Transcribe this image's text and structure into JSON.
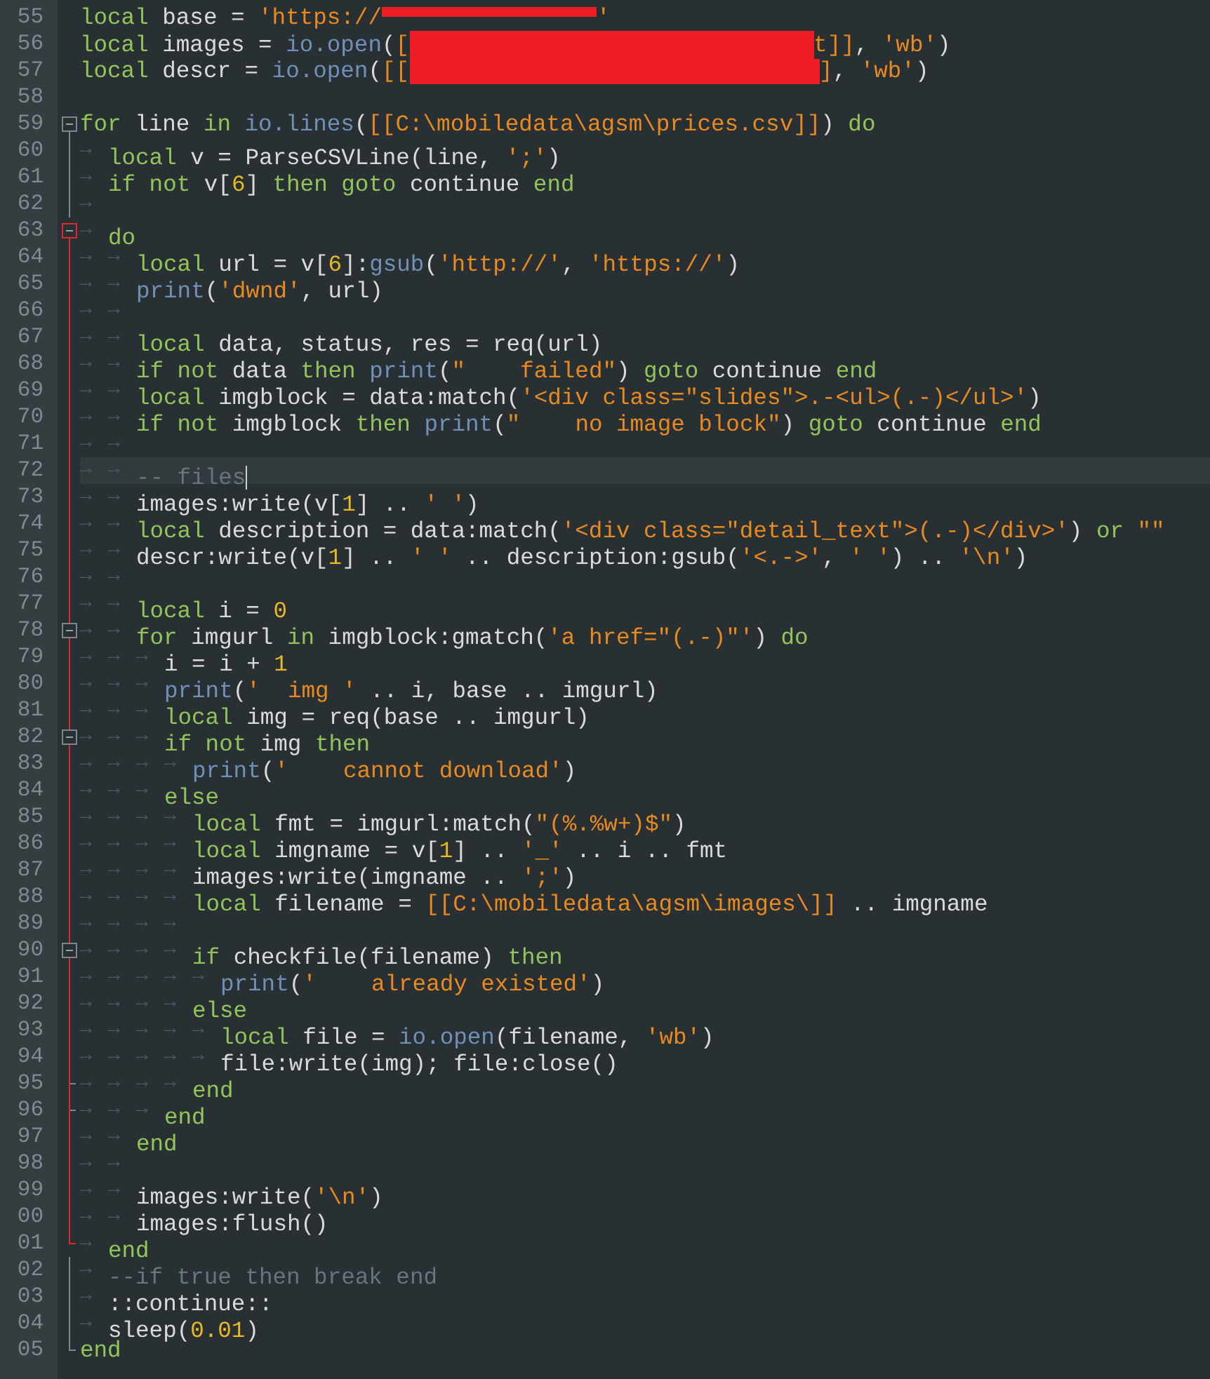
{
  "editor": {
    "lines": [
      {
        "number": "55",
        "current": false,
        "tokens": [
          {
            "kind": "keyword",
            "text": "local"
          },
          {
            "kind": "plain",
            "text": " base = "
          },
          {
            "kind": "string",
            "text": "'https://"
          },
          {
            "kind": "redacted"
          },
          {
            "kind": "string",
            "text": "'"
          }
        ]
      },
      {
        "number": "56",
        "current": false,
        "tokens": [
          {
            "kind": "keyword",
            "text": "local"
          },
          {
            "kind": "plain",
            "text": " images = "
          },
          {
            "kind": "function",
            "text": "io.open"
          },
          {
            "kind": "plain",
            "text": "("
          },
          {
            "kind": "string",
            "text": "["
          },
          {
            "kind": "redacted"
          },
          {
            "kind": "string",
            "text": "t]]"
          },
          {
            "kind": "plain",
            "text": ", "
          },
          {
            "kind": "string",
            "text": "'wb'"
          },
          {
            "kind": "plain",
            "text": ")"
          }
        ]
      },
      {
        "number": "57",
        "current": false,
        "tokens": [
          {
            "kind": "keyword",
            "text": "local"
          },
          {
            "kind": "plain",
            "text": " descr = "
          },
          {
            "kind": "function",
            "text": "io.open"
          },
          {
            "kind": "plain",
            "text": "("
          },
          {
            "kind": "string",
            "text": "[["
          },
          {
            "kind": "redacted"
          },
          {
            "kind": "string",
            "text": "]"
          },
          {
            "kind": "plain",
            "text": ", "
          },
          {
            "kind": "string",
            "text": "'wb'"
          },
          {
            "kind": "plain",
            "text": ")"
          }
        ]
      },
      {
        "number": "58",
        "current": false
      },
      {
        "number": "59",
        "current": false,
        "fold": {
          "kind": "open",
          "active": false
        },
        "tokens": [
          {
            "kind": "keyword",
            "text": "for"
          },
          {
            "kind": "plain",
            "text": " line "
          },
          {
            "kind": "keyword",
            "text": "in "
          },
          {
            "kind": "function",
            "text": "io.lines"
          },
          {
            "kind": "plain",
            "text": "("
          },
          {
            "kind": "string",
            "text": "[[C:\\mobiledata\\agsm\\prices.csv]]"
          },
          {
            "kind": "plain",
            "text": ") "
          },
          {
            "kind": "keyword",
            "text": "do"
          }
        ]
      },
      {
        "number": "60",
        "current": false,
        "fold": {
          "kind": "line",
          "active": false
        },
        "tokens": [
          {
            "kind": "tab",
            "text": "→"
          },
          {
            "kind": "keyword",
            "text": "local"
          },
          {
            "kind": "plain",
            "text": " v = ParseCSVLine(line, "
          },
          {
            "kind": "string",
            "text": "';'"
          },
          {
            "kind": "plain",
            "text": ")"
          }
        ]
      },
      {
        "number": "61",
        "current": false,
        "fold": {
          "kind": "line",
          "active": false
        },
        "tokens": [
          {
            "kind": "tab",
            "text": "→"
          },
          {
            "kind": "keyword",
            "text": "if not"
          },
          {
            "kind": "plain",
            "text": " v["
          },
          {
            "kind": "number",
            "text": "6"
          },
          {
            "kind": "plain",
            "text": "] "
          },
          {
            "kind": "keyword",
            "text": "then goto"
          },
          {
            "kind": "plain",
            "text": " continue "
          },
          {
            "kind": "keyword",
            "text": "end"
          }
        ]
      },
      {
        "number": "62",
        "current": false,
        "fold": {
          "kind": "line",
          "active": false
        },
        "tokens": [
          {
            "kind": "tab",
            "text": "→"
          }
        ]
      },
      {
        "number": "63",
        "current": false,
        "fold": {
          "kind": "open",
          "active": true
        },
        "tokens": [
          {
            "kind": "tab",
            "text": "→"
          },
          {
            "kind": "keyword",
            "text": "do"
          }
        ]
      },
      {
        "number": "64",
        "current": false,
        "fold": {
          "kind": "line",
          "active": true
        },
        "tokens": [
          {
            "kind": "tab",
            "text": "→"
          },
          {
            "kind": "tab",
            "text": "→"
          },
          {
            "kind": "keyword",
            "text": "local"
          },
          {
            "kind": "plain",
            "text": " url = v["
          },
          {
            "kind": "number",
            "text": "6"
          },
          {
            "kind": "plain",
            "text": "]:"
          },
          {
            "kind": "function",
            "text": "gsub"
          },
          {
            "kind": "plain",
            "text": "("
          },
          {
            "kind": "string",
            "text": "'http://'"
          },
          {
            "kind": "plain",
            "text": ", "
          },
          {
            "kind": "string",
            "text": "'https://'"
          },
          {
            "kind": "plain",
            "text": ")"
          }
        ]
      },
      {
        "number": "65",
        "current": false,
        "fold": {
          "kind": "line",
          "active": true
        },
        "tokens": [
          {
            "kind": "tab",
            "text": "→"
          },
          {
            "kind": "tab",
            "text": "→"
          },
          {
            "kind": "function",
            "text": "print"
          },
          {
            "kind": "plain",
            "text": "("
          },
          {
            "kind": "string",
            "text": "'dwnd'"
          },
          {
            "kind": "plain",
            "text": ", url)"
          }
        ]
      },
      {
        "number": "66",
        "current": false,
        "fold": {
          "kind": "line",
          "active": true
        },
        "tokens": [
          {
            "kind": "tab",
            "text": "→"
          },
          {
            "kind": "tab",
            "text": "→"
          }
        ]
      },
      {
        "number": "67",
        "current": false,
        "fold": {
          "kind": "line",
          "active": true
        },
        "tokens": [
          {
            "kind": "tab",
            "text": "→"
          },
          {
            "kind": "tab",
            "text": "→"
          },
          {
            "kind": "keyword",
            "text": "local"
          },
          {
            "kind": "plain",
            "text": " data, status, res = req(url)"
          }
        ]
      },
      {
        "number": "68",
        "current": false,
        "fold": {
          "kind": "line",
          "active": true
        },
        "tokens": [
          {
            "kind": "tab",
            "text": "→"
          },
          {
            "kind": "tab",
            "text": "→"
          },
          {
            "kind": "keyword",
            "text": "if not"
          },
          {
            "kind": "plain",
            "text": " data "
          },
          {
            "kind": "keyword",
            "text": "then "
          },
          {
            "kind": "function",
            "text": "print"
          },
          {
            "kind": "plain",
            "text": "("
          },
          {
            "kind": "string",
            "text": "\"    failed\""
          },
          {
            "kind": "plain",
            "text": ") "
          },
          {
            "kind": "keyword",
            "text": "goto"
          },
          {
            "kind": "plain",
            "text": " continue "
          },
          {
            "kind": "keyword",
            "text": "end"
          }
        ]
      },
      {
        "number": "69",
        "current": false,
        "fold": {
          "kind": "line",
          "active": true
        },
        "tokens": [
          {
            "kind": "tab",
            "text": "→"
          },
          {
            "kind": "tab",
            "text": "→"
          },
          {
            "kind": "keyword",
            "text": "local"
          },
          {
            "kind": "plain",
            "text": " imgblock = data:match("
          },
          {
            "kind": "string",
            "text": "'<div class=\"slides\">.-<ul>(.-)</ul>'"
          },
          {
            "kind": "plain",
            "text": ")"
          }
        ]
      },
      {
        "number": "70",
        "current": false,
        "fold": {
          "kind": "line",
          "active": true
        },
        "tokens": [
          {
            "kind": "tab",
            "text": "→"
          },
          {
            "kind": "tab",
            "text": "→"
          },
          {
            "kind": "keyword",
            "text": "if not"
          },
          {
            "kind": "plain",
            "text": " imgblock "
          },
          {
            "kind": "keyword",
            "text": "then "
          },
          {
            "kind": "function",
            "text": "print"
          },
          {
            "kind": "plain",
            "text": "("
          },
          {
            "kind": "string",
            "text": "\"    no image block\""
          },
          {
            "kind": "plain",
            "text": ") "
          },
          {
            "kind": "keyword",
            "text": "goto"
          },
          {
            "kind": "plain",
            "text": " continue "
          },
          {
            "kind": "keyword",
            "text": "end"
          }
        ]
      },
      {
        "number": "71",
        "current": false,
        "fold": {
          "kind": "line",
          "active": true
        },
        "tokens": [
          {
            "kind": "tab",
            "text": "→"
          },
          {
            "kind": "tab",
            "text": "→"
          }
        ]
      },
      {
        "number": "72",
        "current": true,
        "fold": {
          "kind": "line",
          "active": true
        },
        "tokens": [
          {
            "kind": "tab",
            "text": "→"
          },
          {
            "kind": "tab",
            "text": "→"
          },
          {
            "kind": "comment",
            "text": "-- files"
          }
        ]
      },
      {
        "number": "73",
        "current": false,
        "fold": {
          "kind": "line",
          "active": true
        },
        "tokens": [
          {
            "kind": "tab",
            "text": "→"
          },
          {
            "kind": "tab",
            "text": "→"
          },
          {
            "kind": "plain",
            "text": "images:write(v["
          },
          {
            "kind": "number",
            "text": "1"
          },
          {
            "kind": "plain",
            "text": "] .. "
          },
          {
            "kind": "string",
            "text": "' '"
          },
          {
            "kind": "plain",
            "text": ")"
          }
        ]
      },
      {
        "number": "74",
        "current": false,
        "fold": {
          "kind": "line",
          "active": true
        },
        "tokens": [
          {
            "kind": "tab",
            "text": "→"
          },
          {
            "kind": "tab",
            "text": "→"
          },
          {
            "kind": "keyword",
            "text": "local"
          },
          {
            "kind": "plain",
            "text": " description = data:match("
          },
          {
            "kind": "string",
            "text": "'<div class=\"detail_text\">(.-)</div>'"
          },
          {
            "kind": "plain",
            "text": ") "
          },
          {
            "kind": "keyword",
            "text": "or "
          },
          {
            "kind": "string",
            "text": "\"\""
          }
        ]
      },
      {
        "number": "75",
        "current": false,
        "fold": {
          "kind": "line",
          "active": true
        },
        "tokens": [
          {
            "kind": "tab",
            "text": "→"
          },
          {
            "kind": "tab",
            "text": "→"
          },
          {
            "kind": "plain",
            "text": "descr:write(v["
          },
          {
            "kind": "number",
            "text": "1"
          },
          {
            "kind": "plain",
            "text": "] .. "
          },
          {
            "kind": "string",
            "text": "' '"
          },
          {
            "kind": "plain",
            "text": " .. description:gsub("
          },
          {
            "kind": "string",
            "text": "'<.->'"
          },
          {
            "kind": "plain",
            "text": ", "
          },
          {
            "kind": "string",
            "text": "' '"
          },
          {
            "kind": "plain",
            "text": ") .. "
          },
          {
            "kind": "string",
            "text": "'\\n'"
          },
          {
            "kind": "plain",
            "text": ")"
          }
        ]
      },
      {
        "number": "76",
        "current": false,
        "fold": {
          "kind": "line",
          "active": true
        },
        "tokens": [
          {
            "kind": "tab",
            "text": "→"
          },
          {
            "kind": "tab",
            "text": "→"
          }
        ]
      },
      {
        "number": "77",
        "current": false,
        "fold": {
          "kind": "line",
          "active": true
        },
        "tokens": [
          {
            "kind": "tab",
            "text": "→"
          },
          {
            "kind": "tab",
            "text": "→"
          },
          {
            "kind": "keyword",
            "text": "local"
          },
          {
            "kind": "plain",
            "text": " i = "
          },
          {
            "kind": "number",
            "text": "0"
          }
        ]
      },
      {
        "number": "78",
        "current": false,
        "fold": {
          "kind": "nested",
          "active": true
        },
        "tokens": [
          {
            "kind": "tab",
            "text": "→"
          },
          {
            "kind": "tab",
            "text": "→"
          },
          {
            "kind": "keyword",
            "text": "for"
          },
          {
            "kind": "plain",
            "text": " imgurl "
          },
          {
            "kind": "keyword",
            "text": "in"
          },
          {
            "kind": "plain",
            "text": " imgblock:gmatch("
          },
          {
            "kind": "string",
            "text": "'a href=\"(.-)\"'"
          },
          {
            "kind": "plain",
            "text": ") "
          },
          {
            "kind": "keyword",
            "text": "do"
          }
        ]
      },
      {
        "number": "79",
        "current": false,
        "fold": {
          "kind": "line",
          "active": true
        },
        "tokens": [
          {
            "kind": "tab",
            "text": "→"
          },
          {
            "kind": "tab",
            "text": "→"
          },
          {
            "kind": "tab",
            "text": "→"
          },
          {
            "kind": "plain",
            "text": "i = i + "
          },
          {
            "kind": "number",
            "text": "1"
          }
        ]
      },
      {
        "number": "80",
        "current": false,
        "fold": {
          "kind": "line",
          "active": true
        },
        "tokens": [
          {
            "kind": "tab",
            "text": "→"
          },
          {
            "kind": "tab",
            "text": "→"
          },
          {
            "kind": "tab",
            "text": "→"
          },
          {
            "kind": "function",
            "text": "print"
          },
          {
            "kind": "plain",
            "text": "("
          },
          {
            "kind": "string",
            "text": "'  img '"
          },
          {
            "kind": "plain",
            "text": " .. i, base .. imgurl)"
          }
        ]
      },
      {
        "number": "81",
        "current": false,
        "fold": {
          "kind": "line",
          "active": true
        },
        "tokens": [
          {
            "kind": "tab",
            "text": "→"
          },
          {
            "kind": "tab",
            "text": "→"
          },
          {
            "kind": "tab",
            "text": "→"
          },
          {
            "kind": "keyword",
            "text": "local"
          },
          {
            "kind": "plain",
            "text": " img = req(base .. imgurl)"
          }
        ]
      },
      {
        "number": "82",
        "current": false,
        "fold": {
          "kind": "nested",
          "active": true
        },
        "tokens": [
          {
            "kind": "tab",
            "text": "→"
          },
          {
            "kind": "tab",
            "text": "→"
          },
          {
            "kind": "tab",
            "text": "→"
          },
          {
            "kind": "keyword",
            "text": "if not"
          },
          {
            "kind": "plain",
            "text": " img "
          },
          {
            "kind": "keyword",
            "text": "then"
          }
        ]
      },
      {
        "number": "83",
        "current": false,
        "fold": {
          "kind": "line",
          "active": true
        },
        "tokens": [
          {
            "kind": "tab",
            "text": "→"
          },
          {
            "kind": "tab",
            "text": "→"
          },
          {
            "kind": "tab",
            "text": "→"
          },
          {
            "kind": "tab",
            "text": "→"
          },
          {
            "kind": "function",
            "text": "print"
          },
          {
            "kind": "plain",
            "text": "("
          },
          {
            "kind": "string",
            "text": "'    cannot download'"
          },
          {
            "kind": "plain",
            "text": ")"
          }
        ]
      },
      {
        "number": "84",
        "current": false,
        "fold": {
          "kind": "line",
          "active": true
        },
        "tokens": [
          {
            "kind": "tab",
            "text": "→"
          },
          {
            "kind": "tab",
            "text": "→"
          },
          {
            "kind": "tab",
            "text": "→"
          },
          {
            "kind": "keyword",
            "text": "else"
          }
        ]
      },
      {
        "number": "85",
        "current": false,
        "fold": {
          "kind": "line",
          "active": true
        },
        "tokens": [
          {
            "kind": "tab",
            "text": "→"
          },
          {
            "kind": "tab",
            "text": "→"
          },
          {
            "kind": "tab",
            "text": "→"
          },
          {
            "kind": "tab",
            "text": "→"
          },
          {
            "kind": "keyword",
            "text": "local"
          },
          {
            "kind": "plain",
            "text": " fmt = imgurl:match("
          },
          {
            "kind": "string",
            "text": "\"(%.%w+)$\""
          },
          {
            "kind": "plain",
            "text": ")"
          }
        ]
      },
      {
        "number": "86",
        "current": false,
        "fold": {
          "kind": "line",
          "active": true
        },
        "tokens": [
          {
            "kind": "tab",
            "text": "→"
          },
          {
            "kind": "tab",
            "text": "→"
          },
          {
            "kind": "tab",
            "text": "→"
          },
          {
            "kind": "tab",
            "text": "→"
          },
          {
            "kind": "keyword",
            "text": "local"
          },
          {
            "kind": "plain",
            "text": " imgname = v["
          },
          {
            "kind": "number",
            "text": "1"
          },
          {
            "kind": "plain",
            "text": "] .. "
          },
          {
            "kind": "string",
            "text": "'_'"
          },
          {
            "kind": "plain",
            "text": " .. i .. fmt"
          }
        ]
      },
      {
        "number": "87",
        "current": false,
        "fold": {
          "kind": "line",
          "active": true
        },
        "tokens": [
          {
            "kind": "tab",
            "text": "→"
          },
          {
            "kind": "tab",
            "text": "→"
          },
          {
            "kind": "tab",
            "text": "→"
          },
          {
            "kind": "tab",
            "text": "→"
          },
          {
            "kind": "plain",
            "text": "images:write(imgname .. "
          },
          {
            "kind": "string",
            "text": "';'"
          },
          {
            "kind": "plain",
            "text": ")"
          }
        ]
      },
      {
        "number": "88",
        "current": false,
        "fold": {
          "kind": "line",
          "active": true
        },
        "tokens": [
          {
            "kind": "tab",
            "text": "→"
          },
          {
            "kind": "tab",
            "text": "→"
          },
          {
            "kind": "tab",
            "text": "→"
          },
          {
            "kind": "tab",
            "text": "→"
          },
          {
            "kind": "keyword",
            "text": "local"
          },
          {
            "kind": "plain",
            "text": " filename = "
          },
          {
            "kind": "string",
            "text": "[[C:\\mobiledata\\agsm\\images\\]]"
          },
          {
            "kind": "plain",
            "text": " .. imgname"
          }
        ]
      },
      {
        "number": "89",
        "current": false,
        "fold": {
          "kind": "line",
          "active": true
        },
        "tokens": [
          {
            "kind": "tab",
            "text": "→"
          },
          {
            "kind": "tab",
            "text": "→"
          },
          {
            "kind": "tab",
            "text": "→"
          },
          {
            "kind": "tab",
            "text": "→"
          }
        ]
      },
      {
        "number": "90",
        "current": false,
        "fold": {
          "kind": "nested",
          "active": true
        },
        "tokens": [
          {
            "kind": "tab",
            "text": "→"
          },
          {
            "kind": "tab",
            "text": "→"
          },
          {
            "kind": "tab",
            "text": "→"
          },
          {
            "kind": "tab",
            "text": "→"
          },
          {
            "kind": "keyword",
            "text": "if"
          },
          {
            "kind": "plain",
            "text": " checkfile(filename) "
          },
          {
            "kind": "keyword",
            "text": "then"
          }
        ]
      },
      {
        "number": "91",
        "current": false,
        "fold": {
          "kind": "line",
          "active": true
        },
        "tokens": [
          {
            "kind": "tab",
            "text": "→"
          },
          {
            "kind": "tab",
            "text": "→"
          },
          {
            "kind": "tab",
            "text": "→"
          },
          {
            "kind": "tab",
            "text": "→"
          },
          {
            "kind": "tab",
            "text": "→"
          },
          {
            "kind": "function",
            "text": "print"
          },
          {
            "kind": "plain",
            "text": "("
          },
          {
            "kind": "string",
            "text": "'    already existed'"
          },
          {
            "kind": "plain",
            "text": ")"
          }
        ]
      },
      {
        "number": "92",
        "current": false,
        "fold": {
          "kind": "line",
          "active": true
        },
        "tokens": [
          {
            "kind": "tab",
            "text": "→"
          },
          {
            "kind": "tab",
            "text": "→"
          },
          {
            "kind": "tab",
            "text": "→"
          },
          {
            "kind": "tab",
            "text": "→"
          },
          {
            "kind": "keyword",
            "text": "else"
          }
        ]
      },
      {
        "number": "93",
        "current": false,
        "fold": {
          "kind": "line",
          "active": true
        },
        "tokens": [
          {
            "kind": "tab",
            "text": "→"
          },
          {
            "kind": "tab",
            "text": "→"
          },
          {
            "kind": "tab",
            "text": "→"
          },
          {
            "kind": "tab",
            "text": "→"
          },
          {
            "kind": "tab",
            "text": "→"
          },
          {
            "kind": "keyword",
            "text": "local"
          },
          {
            "kind": "plain",
            "text": " file = "
          },
          {
            "kind": "function",
            "text": "io.open"
          },
          {
            "kind": "plain",
            "text": "(filename, "
          },
          {
            "kind": "string",
            "text": "'wb'"
          },
          {
            "kind": "plain",
            "text": ")"
          }
        ]
      },
      {
        "number": "94",
        "current": false,
        "fold": {
          "kind": "line",
          "active": true
        },
        "tokens": [
          {
            "kind": "tab",
            "text": "→"
          },
          {
            "kind": "tab",
            "text": "→"
          },
          {
            "kind": "tab",
            "text": "→"
          },
          {
            "kind": "tab",
            "text": "→"
          },
          {
            "kind": "tab",
            "text": "→"
          },
          {
            "kind": "plain",
            "text": "file:write(img); file:close()"
          }
        ]
      },
      {
        "number": "95",
        "current": false,
        "fold": {
          "kind": "tick",
          "active": true
        },
        "tokens": [
          {
            "kind": "tab",
            "text": "→"
          },
          {
            "kind": "tab",
            "text": "→"
          },
          {
            "kind": "tab",
            "text": "→"
          },
          {
            "kind": "tab",
            "text": "→"
          },
          {
            "kind": "keyword",
            "text": "end"
          }
        ]
      },
      {
        "number": "96",
        "current": false,
        "fold": {
          "kind": "tick",
          "active": true
        },
        "tokens": [
          {
            "kind": "tab",
            "text": "→"
          },
          {
            "kind": "tab",
            "text": "→"
          },
          {
            "kind": "tab",
            "text": "→"
          },
          {
            "kind": "keyword",
            "text": "end"
          }
        ]
      },
      {
        "number": "97",
        "current": false,
        "fold": {
          "kind": "line",
          "active": true
        },
        "tokens": [
          {
            "kind": "tab",
            "text": "→"
          },
          {
            "kind": "tab",
            "text": "→"
          },
          {
            "kind": "keyword",
            "text": "end"
          }
        ]
      },
      {
        "number": "98",
        "current": false,
        "fold": {
          "kind": "line",
          "active": true
        },
        "tokens": [
          {
            "kind": "tab",
            "text": "→"
          },
          {
            "kind": "tab",
            "text": "→"
          }
        ]
      },
      {
        "number": "99",
        "current": false,
        "fold": {
          "kind": "line",
          "active": true
        },
        "tokens": [
          {
            "kind": "tab",
            "text": "→"
          },
          {
            "kind": "tab",
            "text": "→"
          },
          {
            "kind": "plain",
            "text": "images:write("
          },
          {
            "kind": "string",
            "text": "'\\n'"
          },
          {
            "kind": "plain",
            "text": ")"
          }
        ]
      },
      {
        "number": "00",
        "current": false,
        "fold": {
          "kind": "line",
          "active": true
        },
        "tokens": [
          {
            "kind": "tab",
            "text": "→"
          },
          {
            "kind": "tab",
            "text": "→"
          },
          {
            "kind": "plain",
            "text": "images:flush()"
          }
        ]
      },
      {
        "number": "01",
        "current": false,
        "fold": {
          "kind": "end",
          "active": true
        },
        "tokens": [
          {
            "kind": "tab",
            "text": "→"
          },
          {
            "kind": "keyword",
            "text": "end"
          }
        ]
      },
      {
        "number": "02",
        "current": false,
        "fold": {
          "kind": "line",
          "active": false
        },
        "tokens": [
          {
            "kind": "tab",
            "text": "→"
          },
          {
            "kind": "comment",
            "text": "--if true then break end"
          }
        ]
      },
      {
        "number": "03",
        "current": false,
        "fold": {
          "kind": "line",
          "active": false
        },
        "tokens": [
          {
            "kind": "tab",
            "text": "→"
          },
          {
            "kind": "plain",
            "text": "::continue::"
          }
        ]
      },
      {
        "number": "04",
        "current": false,
        "fold": {
          "kind": "line",
          "active": false
        },
        "tokens": [
          {
            "kind": "tab",
            "text": "→"
          },
          {
            "kind": "plain",
            "text": "sleep("
          },
          {
            "kind": "number",
            "text": "0.01"
          },
          {
            "kind": "plain",
            "text": ")"
          }
        ]
      },
      {
        "number": "05",
        "current": false,
        "fold": {
          "kind": "end",
          "active": false
        },
        "tokens": [
          {
            "kind": "keyword",
            "text": "end"
          }
        ]
      }
    ]
  }
}
